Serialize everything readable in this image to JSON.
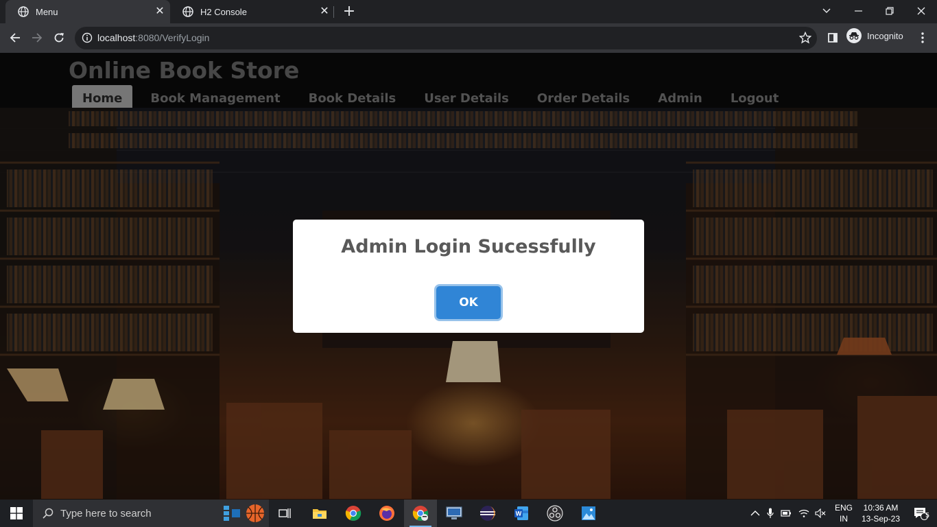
{
  "browser": {
    "tabs": [
      {
        "title": "Menu",
        "active": true
      },
      {
        "title": "H2 Console",
        "active": false
      }
    ],
    "url_host": "localhost",
    "url_path": ":8080/VerifyLogin",
    "profile_label": "Incognito"
  },
  "site": {
    "brand": "Online Book Store",
    "nav": [
      {
        "label": "Home",
        "active": true
      },
      {
        "label": "Book Management"
      },
      {
        "label": "Book Details"
      },
      {
        "label": "User Details"
      },
      {
        "label": "Order Details"
      },
      {
        "label": "Admin"
      },
      {
        "label": "Logout"
      }
    ]
  },
  "dialog": {
    "title": "Admin Login Sucessfully",
    "ok_label": "OK",
    "ok_color": "#3085d6"
  },
  "taskbar": {
    "search_placeholder": "Type here to search",
    "lang_line1": "ENG",
    "lang_line2": "IN",
    "time": "10:36 AM",
    "date": "13-Sep-23",
    "notification_count": "5",
    "apps": [
      "task-view",
      "file-explorer",
      "chrome",
      "firefox",
      "chrome-incognito",
      "remote-desktop",
      "eclipse",
      "word",
      "obs",
      "photos"
    ]
  },
  "colors": {
    "titlebar": "#202124",
    "toolbar": "#35363a",
    "page_header": "#0c0c0c",
    "taskbar": "#1e2024"
  }
}
